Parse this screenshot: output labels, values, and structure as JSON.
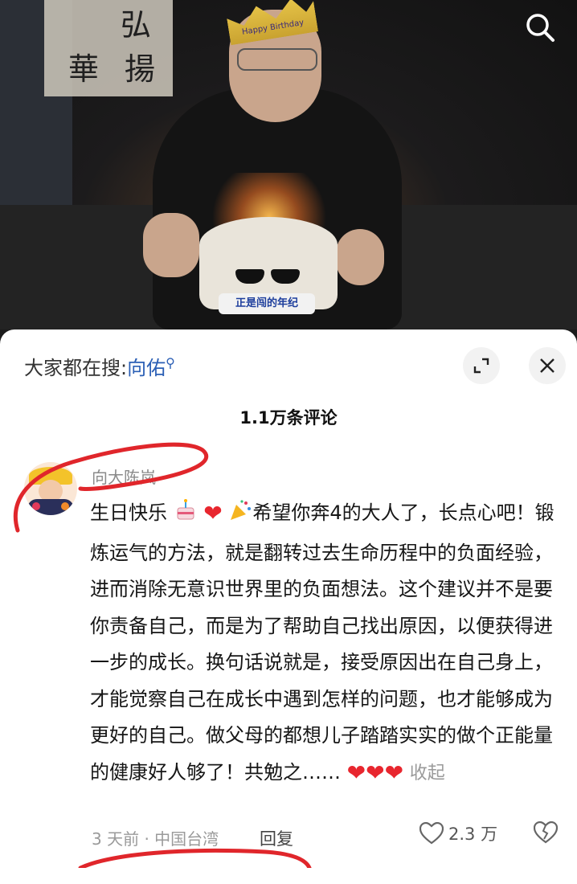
{
  "photo": {
    "hat_text": "Happy Birthday",
    "cake_band_text": "正是闯的年纪"
  },
  "search_hint": {
    "prefix": "大家都在搜:",
    "keyword": "向佑"
  },
  "comments_count": "1.1万条评论",
  "comment": {
    "username": "向大陈岚",
    "text_part1": "生日快乐",
    "text_part2": "希望你奔4的大人了，长点心吧！锻炼运气的方法，就是翻转过去生命历程中的负面经验，进而消除无意识世界里的负面想法。这个建议并不是要你责备自己，而是为了帮助自己找出原因，以便获得进一步的成长。换句话说就是，接受原因出在自己身上，才能觉察自己在成长中遇到怎样的问题，也才能够成为更好的自己。做父母的都想儿子踏踏实实的做个正能量的健康好人够了！共勉之……",
    "collapse_label": "收起",
    "time_location": "3 天前 · 中国台湾",
    "reply_label": "回复",
    "like_count": "2.3 万"
  },
  "colors": {
    "annotation_red": "#e0262b",
    "keyword_blue": "#2b5fb5",
    "heart_red": "#e8262e"
  },
  "icons": [
    "search-icon",
    "expand-icon",
    "close-icon",
    "cake-emoji",
    "heart-emoji",
    "party-popper-emoji",
    "like-heart-icon",
    "dislike-icon"
  ]
}
